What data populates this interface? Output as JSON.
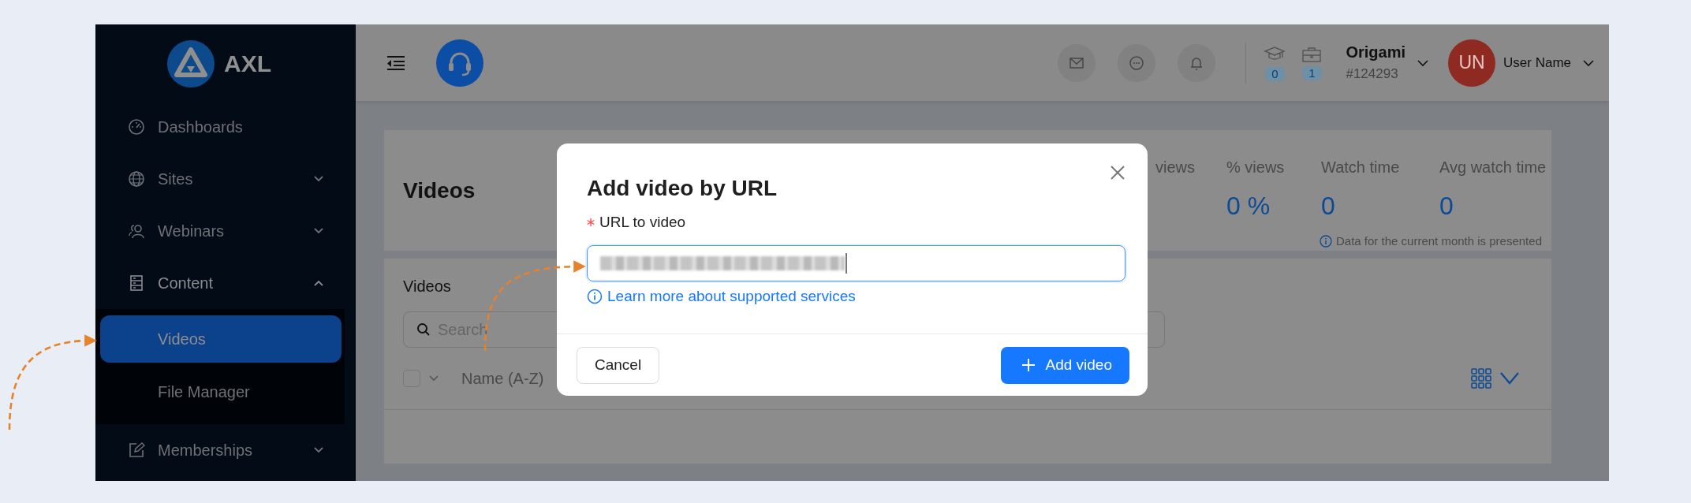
{
  "sidebar": {
    "logo": "AXL",
    "items": [
      {
        "label": "Dashboards",
        "kind": "link"
      },
      {
        "label": "Sites",
        "kind": "group",
        "expanded": false
      },
      {
        "label": "Webinars",
        "kind": "group",
        "expanded": false
      },
      {
        "label": "Content",
        "kind": "group",
        "expanded": true,
        "children": [
          {
            "label": "Videos",
            "selected": true
          },
          {
            "label": "File Manager",
            "selected": false
          }
        ]
      },
      {
        "label": "Memberships",
        "kind": "group",
        "expanded": false
      }
    ]
  },
  "header": {
    "courses_count": "0",
    "cases_count": "1",
    "account": {
      "name": "Origami",
      "id": "#124293"
    },
    "user": {
      "initials": "UN",
      "name": "User Name"
    }
  },
  "stats": {
    "title": "Videos",
    "metrics": [
      {
        "label": "views"
      },
      {
        "label": "% views",
        "value": "0 %"
      },
      {
        "label": "Watch time",
        "value": "0"
      },
      {
        "label": "Avg watch time",
        "value": "0"
      }
    ],
    "note": "Data for the current month is presented"
  },
  "videos_list": {
    "title": "Videos",
    "search": {
      "placeholder": "Search"
    },
    "select_all": {
      "checked": false
    },
    "sort": "Name (A-Z)"
  },
  "modal": {
    "title": "Add video by URL",
    "field": {
      "label": "URL to video",
      "required": true
    },
    "help_link": "Learn more about supported services",
    "buttons": [
      {
        "label": "Cancel",
        "kind": "secondary"
      },
      {
        "label": "Add video",
        "kind": "primary"
      }
    ]
  }
}
